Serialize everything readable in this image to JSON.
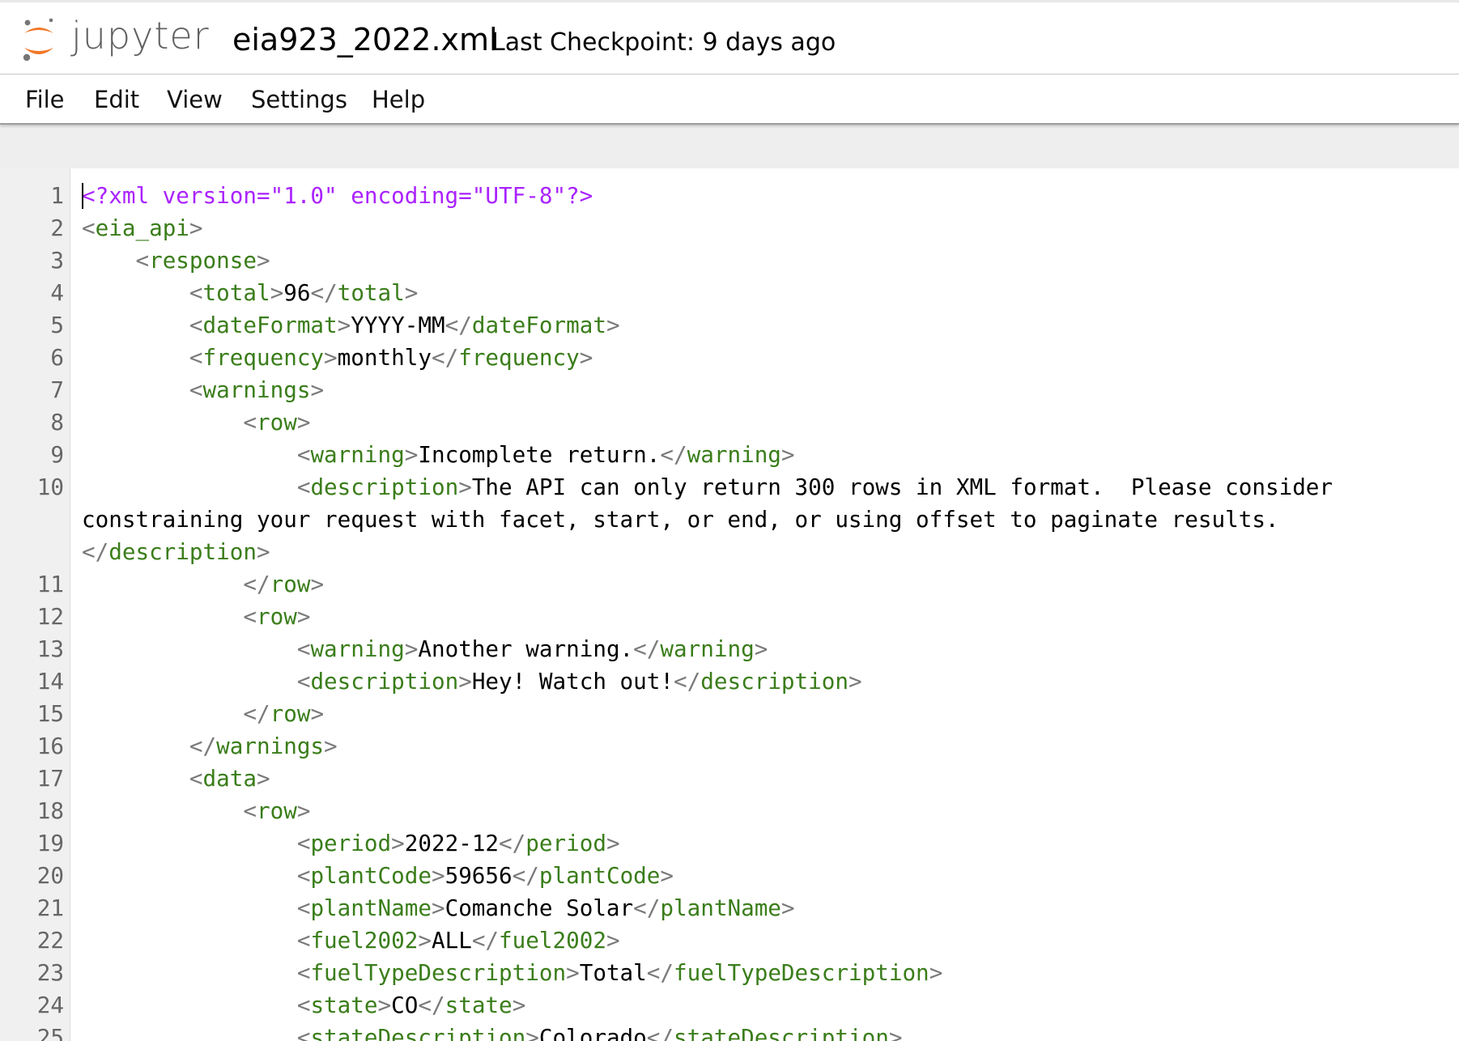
{
  "header": {
    "logo_text": "jupyter",
    "doc_title": "eia923_2022.xml",
    "checkpoint": "Last Checkpoint: 9 days ago"
  },
  "menu": [
    "File",
    "Edit",
    "View",
    "Settings",
    "Help"
  ],
  "colors": {
    "tag": "#3a7d1a",
    "bracket": "#7a7a7a",
    "declaration": "#aa22ff",
    "logo_orange": "#f37726"
  },
  "code_lines": [
    {
      "n": "1",
      "indent": 0,
      "type": "decl",
      "text": "<?xml version=\"1.0\" encoding=\"UTF-8\"?>"
    },
    {
      "n": "2",
      "indent": 0,
      "type": "open",
      "tag": "eia_api"
    },
    {
      "n": "3",
      "indent": 1,
      "type": "open",
      "tag": "response"
    },
    {
      "n": "4",
      "indent": 2,
      "type": "elem",
      "tag": "total",
      "value": "96"
    },
    {
      "n": "5",
      "indent": 2,
      "type": "elem",
      "tag": "dateFormat",
      "value": "YYYY-MM"
    },
    {
      "n": "6",
      "indent": 2,
      "type": "elem",
      "tag": "frequency",
      "value": "monthly"
    },
    {
      "n": "7",
      "indent": 2,
      "type": "open",
      "tag": "warnings"
    },
    {
      "n": "8",
      "indent": 3,
      "type": "open",
      "tag": "row"
    },
    {
      "n": "9",
      "indent": 4,
      "type": "elem",
      "tag": "warning",
      "value": "Incomplete return."
    },
    {
      "n": "10",
      "indent": 4,
      "type": "wrap",
      "tag": "description",
      "value1": "The API can only return 300 rows in XML format.  Please consider",
      "value2": "constraining your request with facet, start, or end, or using offset to paginate results."
    },
    {
      "n": "11",
      "indent": 3,
      "type": "close",
      "tag": "row"
    },
    {
      "n": "12",
      "indent": 3,
      "type": "open",
      "tag": "row"
    },
    {
      "n": "13",
      "indent": 4,
      "type": "elem",
      "tag": "warning",
      "value": "Another warning."
    },
    {
      "n": "14",
      "indent": 4,
      "type": "elem",
      "tag": "description",
      "value": "Hey! Watch out!"
    },
    {
      "n": "15",
      "indent": 3,
      "type": "close",
      "tag": "row"
    },
    {
      "n": "16",
      "indent": 2,
      "type": "close",
      "tag": "warnings"
    },
    {
      "n": "17",
      "indent": 2,
      "type": "open",
      "tag": "data"
    },
    {
      "n": "18",
      "indent": 3,
      "type": "open",
      "tag": "row"
    },
    {
      "n": "19",
      "indent": 4,
      "type": "elem",
      "tag": "period",
      "value": "2022-12"
    },
    {
      "n": "20",
      "indent": 4,
      "type": "elem",
      "tag": "plantCode",
      "value": "59656"
    },
    {
      "n": "21",
      "indent": 4,
      "type": "elem",
      "tag": "plantName",
      "value": "Comanche Solar"
    },
    {
      "n": "22",
      "indent": 4,
      "type": "elem",
      "tag": "fuel2002",
      "value": "ALL"
    },
    {
      "n": "23",
      "indent": 4,
      "type": "elem",
      "tag": "fuelTypeDescription",
      "value": "Total"
    },
    {
      "n": "24",
      "indent": 4,
      "type": "elem",
      "tag": "state",
      "value": "CO"
    },
    {
      "n": "25",
      "indent": 4,
      "type": "elem",
      "tag": "stateDescription",
      "value": "Colorado"
    }
  ]
}
